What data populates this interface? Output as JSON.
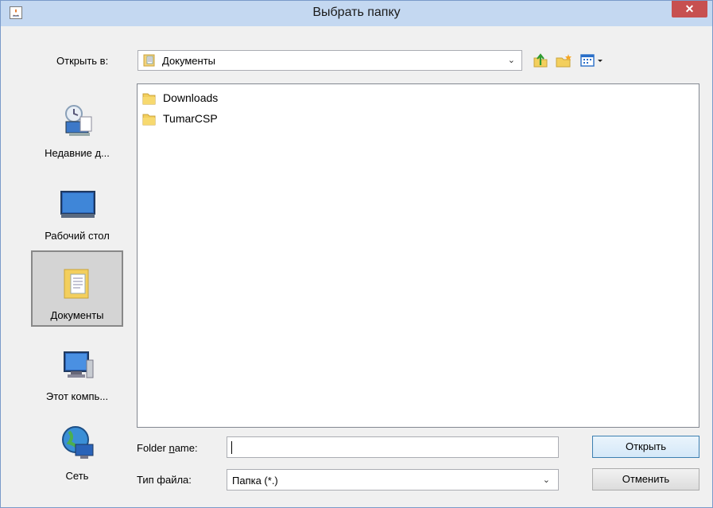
{
  "window": {
    "title": "Выбрать папку",
    "close_label": "✕"
  },
  "lookin": {
    "label": "Открыть в:",
    "value": "Документы"
  },
  "places": [
    {
      "label": "Недавние д..."
    },
    {
      "label": "Рабочий стол"
    },
    {
      "label": "Документы"
    },
    {
      "label": "Этот компь..."
    },
    {
      "label": "Сеть"
    }
  ],
  "files": [
    {
      "name": "Downloads"
    },
    {
      "name": "TumarCSP"
    }
  ],
  "folder_name": {
    "label_prefix": "Folder ",
    "label_mnemonic": "n",
    "label_suffix": "ame:",
    "value": ""
  },
  "file_type": {
    "label": "Тип файла:",
    "value": "Папка (*.)"
  },
  "buttons": {
    "open": "Открыть",
    "cancel": "Отменить"
  }
}
